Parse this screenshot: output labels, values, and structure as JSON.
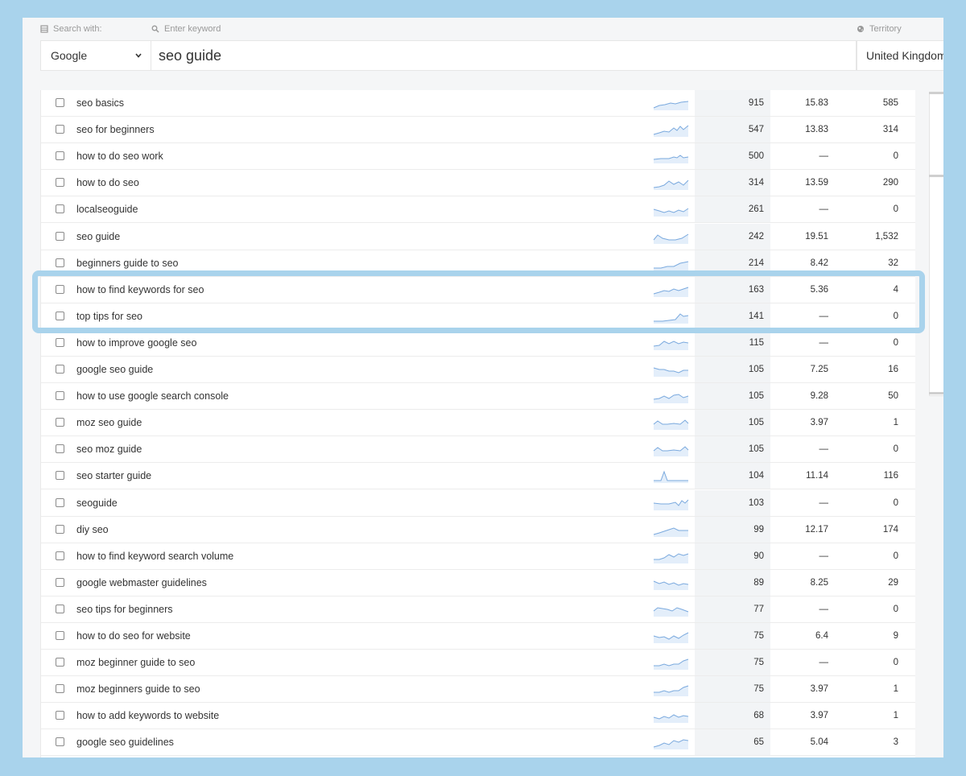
{
  "search": {
    "search_with_label": "Search with:",
    "keyword_label": "Enter keyword",
    "territory_label": "Territory",
    "engine_value": "Google",
    "keyword_value": "seo guide",
    "territory_value": "United Kingdom"
  },
  "colors": {
    "accent": "#a9d3ec",
    "trend": "#7aa9de"
  },
  "keywords": [
    {
      "kw": "seo basics",
      "vol": "915",
      "kd": "15.83",
      "res": "585"
    },
    {
      "kw": "seo for beginners",
      "vol": "547",
      "kd": "13.83",
      "res": "314"
    },
    {
      "kw": "how to do seo work",
      "vol": "500",
      "kd": "—",
      "res": "0"
    },
    {
      "kw": "how to do seo",
      "vol": "314",
      "kd": "13.59",
      "res": "290"
    },
    {
      "kw": "localseoguide",
      "vol": "261",
      "kd": "—",
      "res": "0"
    },
    {
      "kw": "seo guide",
      "vol": "242",
      "kd": "19.51",
      "res": "1,532"
    },
    {
      "kw": "beginners guide to seo",
      "vol": "214",
      "kd": "8.42",
      "res": "32"
    },
    {
      "kw": "how to find keywords for seo",
      "vol": "163",
      "kd": "5.36",
      "res": "4"
    },
    {
      "kw": "top tips for seo",
      "vol": "141",
      "kd": "—",
      "res": "0"
    },
    {
      "kw": "how to improve google seo",
      "vol": "115",
      "kd": "—",
      "res": "0"
    },
    {
      "kw": "google seo guide",
      "vol": "105",
      "kd": "7.25",
      "res": "16"
    },
    {
      "kw": "how to use google search console",
      "vol": "105",
      "kd": "9.28",
      "res": "50"
    },
    {
      "kw": "moz seo guide",
      "vol": "105",
      "kd": "3.97",
      "res": "1"
    },
    {
      "kw": "seo moz guide",
      "vol": "105",
      "kd": "—",
      "res": "0"
    },
    {
      "kw": "seo starter guide",
      "vol": "104",
      "kd": "11.14",
      "res": "116"
    },
    {
      "kw": "seoguide",
      "vol": "103",
      "kd": "—",
      "res": "0"
    },
    {
      "kw": "diy seo",
      "vol": "99",
      "kd": "12.17",
      "res": "174"
    },
    {
      "kw": "how to find keyword search volume",
      "vol": "90",
      "kd": "—",
      "res": "0"
    },
    {
      "kw": "google webmaster guidelines",
      "vol": "89",
      "kd": "8.25",
      "res": "29"
    },
    {
      "kw": "seo tips for beginners",
      "vol": "77",
      "kd": "—",
      "res": "0"
    },
    {
      "kw": "how to do seo for website",
      "vol": "75",
      "kd": "6.4",
      "res": "9"
    },
    {
      "kw": "moz beginner guide to seo",
      "vol": "75",
      "kd": "—",
      "res": "0"
    },
    {
      "kw": "moz beginners guide to seo",
      "vol": "75",
      "kd": "3.97",
      "res": "1"
    },
    {
      "kw": "how to add keywords to website",
      "vol": "68",
      "kd": "3.97",
      "res": "1"
    },
    {
      "kw": "google seo guidelines",
      "vol": "65",
      "kd": "5.04",
      "res": "3"
    }
  ]
}
